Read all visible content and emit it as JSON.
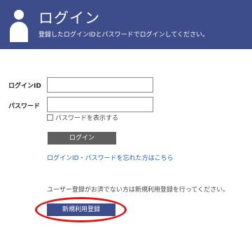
{
  "header": {
    "title": "ログイン",
    "subtitle": "登録したログインIDとパスワードでログインしてください。",
    "icon": "user-icon",
    "background_color": "#3d4c8a"
  },
  "form": {
    "login_id_label": "ログインID",
    "login_id_value": "",
    "password_label": "パスワード",
    "password_value": "",
    "show_password_label": "パスワードを表示する",
    "show_password_checked": false
  },
  "actions": {
    "login_button_label": "ログイン",
    "forgot_link_text": "ログインID・パスワードを忘れた方はこちら",
    "link_color": "#1a5fb4"
  },
  "register": {
    "note": "ユーザー登録がお済でない方は新規利用登録を行ってください。",
    "button_label": "新規利用登録",
    "highlight_color": "#e01515"
  }
}
